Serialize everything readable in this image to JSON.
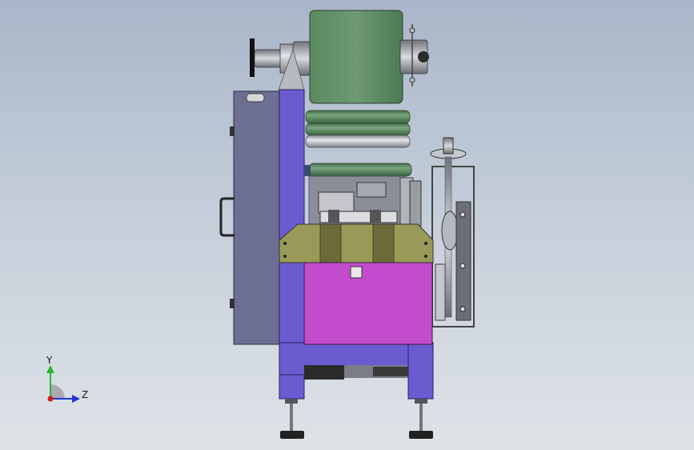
{
  "triad": {
    "y_label": "Y",
    "z_label": "Z",
    "colors": {
      "y": "#2bb52b",
      "z": "#1f35d6",
      "x": "#d81b1b"
    }
  },
  "colors": {
    "frame_purple": "#6b5bd1",
    "hopper_magenta": "#c24ccc",
    "roller_green": "#5e8f63",
    "guard_slate": "#6c6f92",
    "olive_block": "#9a9a58",
    "steel": "#b9bcc3"
  }
}
